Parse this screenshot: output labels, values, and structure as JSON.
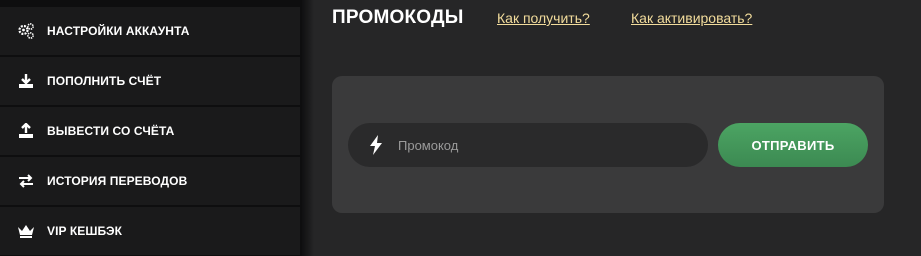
{
  "sidebar": {
    "items": [
      {
        "label": "НАСТРОЙКИ АККАУНТА",
        "icon": "gears-icon"
      },
      {
        "label": "ПОПОЛНИТЬ СЧЁТ",
        "icon": "download-icon"
      },
      {
        "label": "ВЫВЕСТИ СО СЧЁТА",
        "icon": "upload-icon"
      },
      {
        "label": "ИСТОРИЯ ПЕРЕВОДОВ",
        "icon": "transfer-arrows-icon"
      },
      {
        "label": "VIP КЕШБЭК",
        "icon": "crown-icon"
      }
    ]
  },
  "main": {
    "title": "ПРОМОКОДЫ",
    "links": {
      "how_to_get": "Как получить?",
      "how_to_activate": "Как активировать?"
    },
    "promo": {
      "placeholder": "Промокод",
      "icon": "lightning-icon",
      "submit_label": "ОТПРАВИТЬ"
    }
  },
  "colors": {
    "background": "#262627",
    "sidebar": "#1a1a1b",
    "panel": "#3a3a3b",
    "link": "#f2dc9c",
    "button": "#44985a"
  }
}
